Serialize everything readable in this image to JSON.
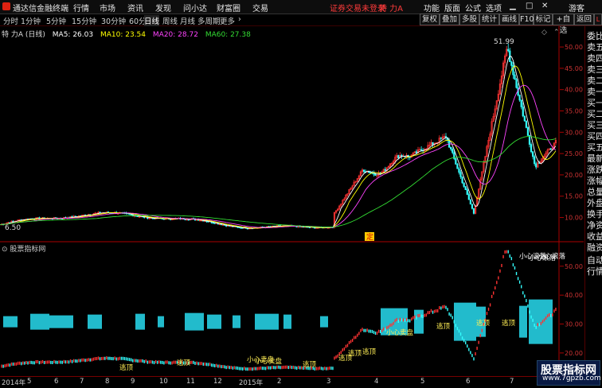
{
  "menu": {
    "app_name": "通达信金融终端",
    "items": [
      "行情",
      "市场",
      "资讯",
      "发现",
      "问小达",
      "财富圈",
      "交易"
    ],
    "login_notice": "证券交易未登录",
    "stock_name": "特 力A",
    "right_items": [
      "功能",
      "版面",
      "公式",
      "选项"
    ],
    "guest": "游客"
  },
  "periods": [
    "分时",
    "1分钟",
    "5分钟",
    "15分钟",
    "30分钟",
    "60分钟",
    "日线",
    "周线",
    "月线",
    "多周期",
    "更多"
  ],
  "active_period": "日线",
  "toolbar": [
    "复权",
    "叠加",
    "多股",
    "统计",
    "画线",
    "F10",
    "标记",
    "+自选",
    "返回"
  ],
  "chart_header": {
    "stock": "特 力A (日线)",
    "ma": [
      {
        "label": "MA5: 26.03",
        "color": "#ffffff"
      },
      {
        "label": "MA10: 23.54",
        "color": "#ffff00"
      },
      {
        "label": "MA20: 28.72",
        "color": "#ff44ff"
      },
      {
        "label": "MA60: 27.38",
        "color": "#33dd33"
      }
    ]
  },
  "main_axis": {
    "ticks": [
      "50.00",
      "45.00",
      "40.00",
      "35.00",
      "30.00",
      "25.00",
      "20.00",
      "15.00",
      "10.00"
    ]
  },
  "annotations": {
    "high": "51.99",
    "low": "6.50",
    "marker": "定"
  },
  "indicator": {
    "title": "股票指标网",
    "ticks": [
      "50.00",
      "40.00",
      "30.00",
      "20.00"
    ],
    "labels": [
      "小心滚落",
      "小心滚落",
      "小心滚落",
      "逃顶",
      "逃顶",
      "逃顶",
      "逃顶",
      "逃顶",
      "小心卖盘",
      "小心卖盘",
      "逃顶",
      "逃顶",
      "逃顶",
      "小心卖盘",
      "逃顶"
    ]
  },
  "right_panel": [
    "委比",
    "卖五",
    "卖四",
    "卖三",
    "卖二",
    "卖一",
    "买一",
    "买二",
    "买三",
    "买四",
    "买五",
    "最新",
    "涨跌",
    "涨幅",
    "总量",
    "外盘",
    "换手",
    "净资",
    "收益",
    "融资",
    "自动",
    "行情"
  ],
  "dates": [
    "2014年",
    "5",
    "6",
    "7",
    "8",
    "9",
    "10",
    "11",
    "12",
    "2015年",
    "2",
    "3",
    "4",
    "5",
    "6",
    "7",
    "8"
  ],
  "watermark": {
    "title": "股票指标网",
    "url": "www.7gpzb.com"
  },
  "colors": {
    "up": "#ff3333",
    "down": "#33ffff",
    "ma5": "#ffffff",
    "ma10": "#ffff00",
    "ma20": "#ff44ff",
    "ma60": "#33dd33",
    "axis": "#aa0000"
  }
}
